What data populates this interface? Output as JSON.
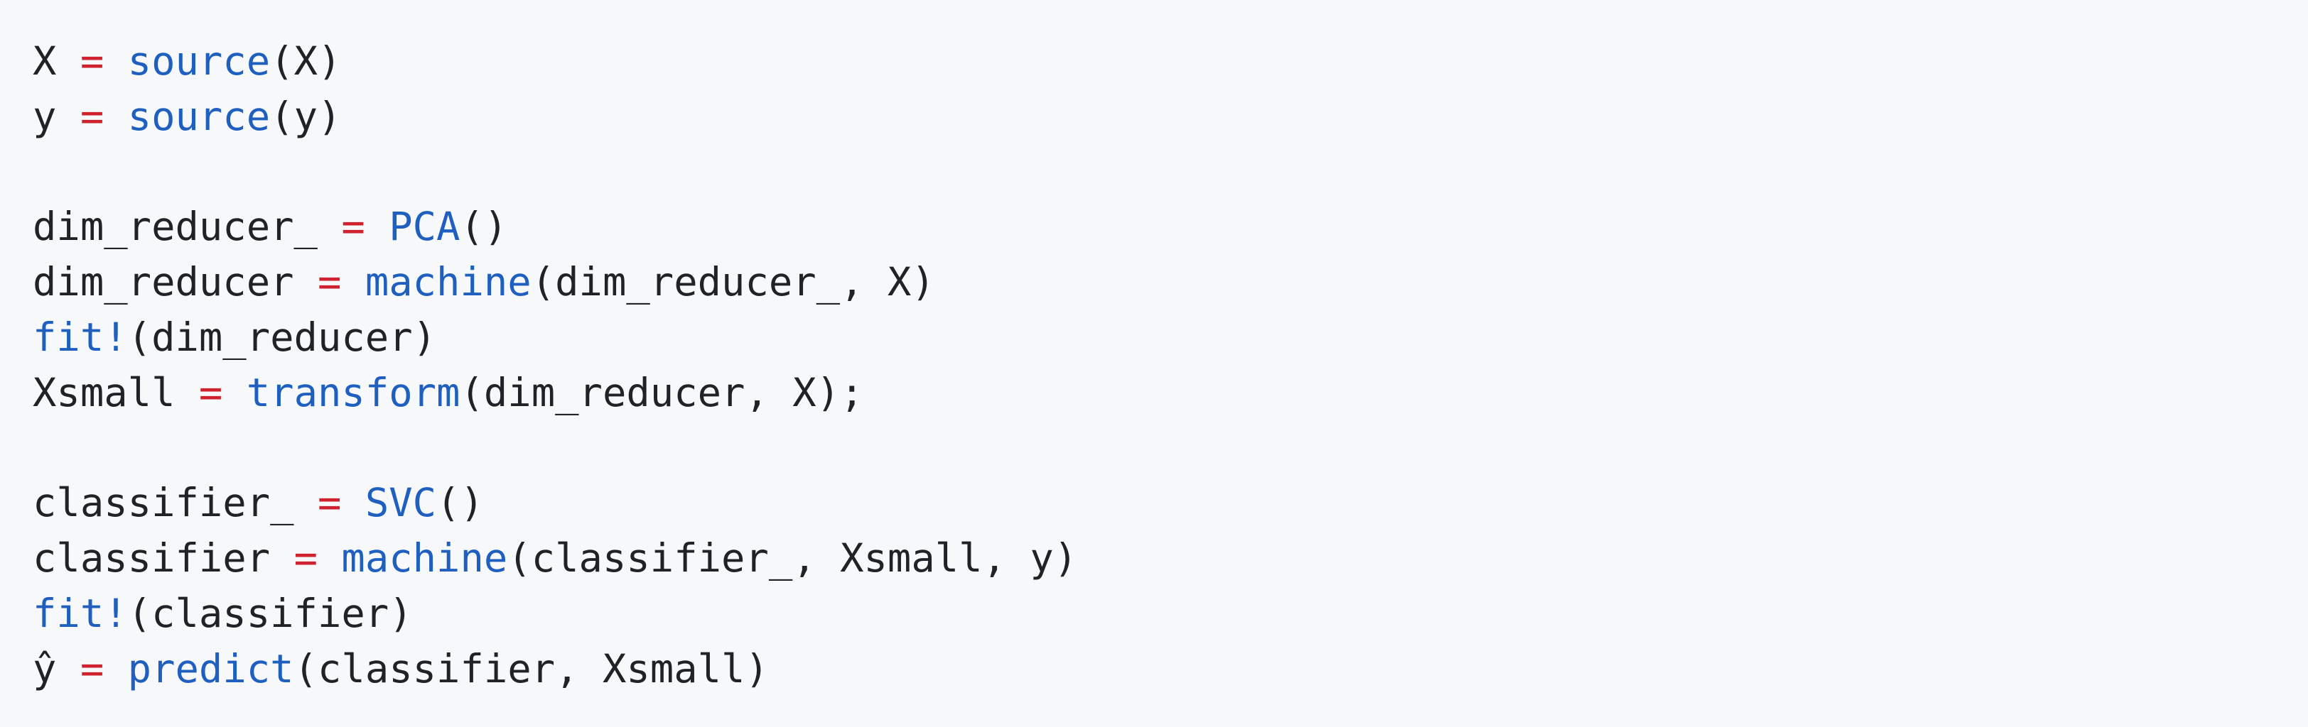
{
  "code": {
    "language": "julia",
    "colors": {
      "background": "#f6f8fa",
      "text": "#1f2328",
      "operator": "#cf222e",
      "function": "#1f5fbf"
    },
    "lines": [
      [
        {
          "t": "plain",
          "v": "X "
        },
        {
          "t": "op",
          "v": "="
        },
        {
          "t": "plain",
          "v": " "
        },
        {
          "t": "fn",
          "v": "source"
        },
        {
          "t": "punct",
          "v": "(X)"
        }
      ],
      [
        {
          "t": "plain",
          "v": "y "
        },
        {
          "t": "op",
          "v": "="
        },
        {
          "t": "plain",
          "v": " "
        },
        {
          "t": "fn",
          "v": "source"
        },
        {
          "t": "punct",
          "v": "(y)"
        }
      ],
      [],
      [
        {
          "t": "plain",
          "v": "dim_reducer_ "
        },
        {
          "t": "op",
          "v": "="
        },
        {
          "t": "plain",
          "v": " "
        },
        {
          "t": "fn",
          "v": "PCA"
        },
        {
          "t": "punct",
          "v": "()"
        }
      ],
      [
        {
          "t": "plain",
          "v": "dim_reducer "
        },
        {
          "t": "op",
          "v": "="
        },
        {
          "t": "plain",
          "v": " "
        },
        {
          "t": "fn",
          "v": "machine"
        },
        {
          "t": "punct",
          "v": "(dim_reducer_, X)"
        }
      ],
      [
        {
          "t": "fn",
          "v": "fit!"
        },
        {
          "t": "punct",
          "v": "(dim_reducer)"
        }
      ],
      [
        {
          "t": "plain",
          "v": "Xsmall "
        },
        {
          "t": "op",
          "v": "="
        },
        {
          "t": "plain",
          "v": " "
        },
        {
          "t": "fn",
          "v": "transform"
        },
        {
          "t": "punct",
          "v": "(dim_reducer, X);"
        }
      ],
      [],
      [
        {
          "t": "plain",
          "v": "classifier_ "
        },
        {
          "t": "op",
          "v": "="
        },
        {
          "t": "plain",
          "v": " "
        },
        {
          "t": "fn",
          "v": "SVC"
        },
        {
          "t": "punct",
          "v": "()"
        }
      ],
      [
        {
          "t": "plain",
          "v": "classifier "
        },
        {
          "t": "op",
          "v": "="
        },
        {
          "t": "plain",
          "v": " "
        },
        {
          "t": "fn",
          "v": "machine"
        },
        {
          "t": "punct",
          "v": "(classifier_, Xsmall, y)"
        }
      ],
      [
        {
          "t": "fn",
          "v": "fit!"
        },
        {
          "t": "punct",
          "v": "(classifier)"
        }
      ],
      [
        {
          "t": "plain",
          "v": "ŷ "
        },
        {
          "t": "op",
          "v": "="
        },
        {
          "t": "plain",
          "v": " "
        },
        {
          "t": "fn",
          "v": "predict"
        },
        {
          "t": "punct",
          "v": "(classifier, Xsmall)"
        }
      ]
    ]
  }
}
